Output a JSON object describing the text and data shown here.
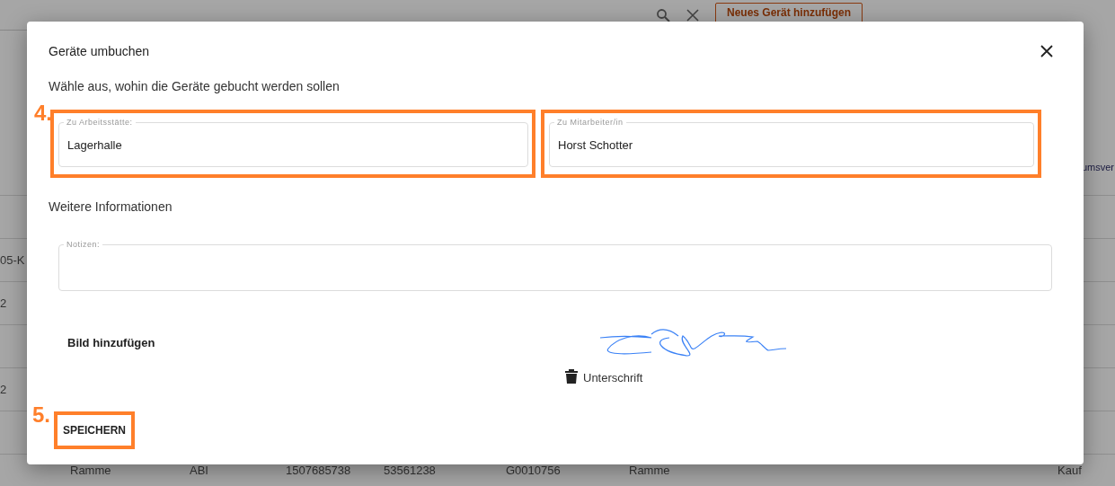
{
  "background_page": {
    "add_button": "Neues Gerät hinzufügen",
    "table_header_fragment": "umsver",
    "row_fragments": [
      "05-K",
      "2",
      "2"
    ],
    "last_row": [
      "Ramme",
      "ABI",
      "1507685738",
      "53561238",
      "G0010756",
      "Ramme",
      "Kauf"
    ]
  },
  "dialog": {
    "title": "Geräte umbuchen",
    "instruction": "Wähle aus, wohin die Geräte gebucht werden sollen",
    "step_marker": "4.",
    "fields": [
      {
        "label": "Zu Arbeitsstätte:",
        "value": "Lagerhalle",
        "highlighted": true
      },
      {
        "label": "Zu Mitarbeiter/in",
        "value": "Horst Schotter",
        "highlighted": true
      }
    ],
    "section_heading": "Weitere Informationen",
    "notes": {
      "label": "Notizen:"
    },
    "add_image_button": "Bild hinzufügen",
    "signature_label": "Unterschrift",
    "save_marker": "5.",
    "save_button": {
      "label": "SPEICHERN",
      "highlighted": true
    }
  }
}
